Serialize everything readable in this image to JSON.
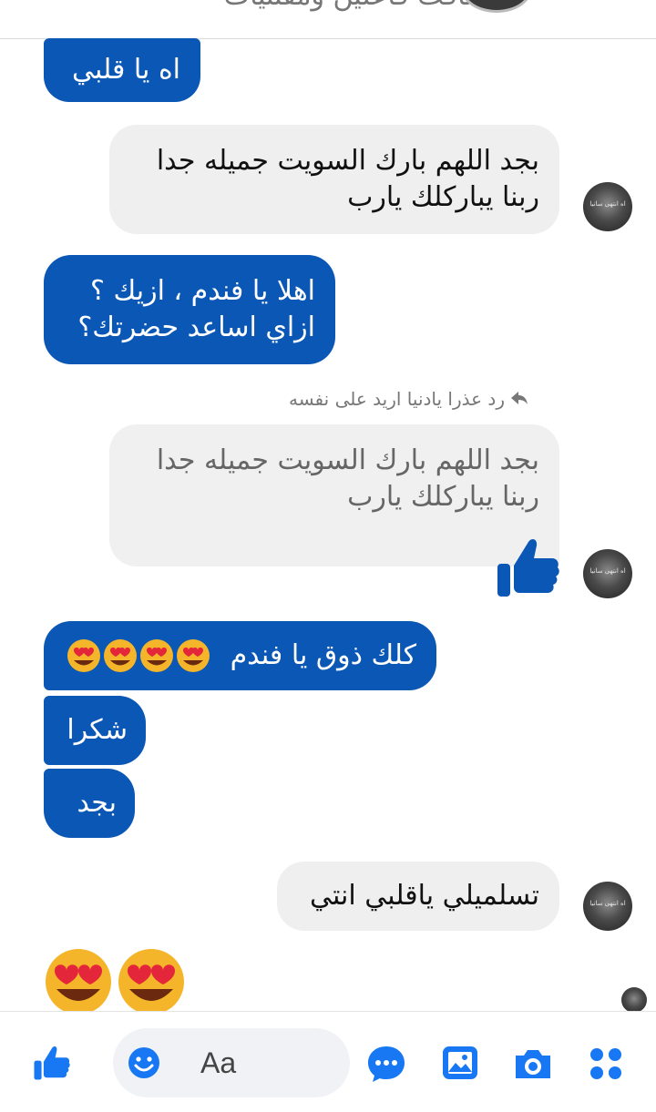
{
  "header": {
    "title_fragment": "أضافت فاعلين ومقتنيات"
  },
  "messages": [
    {
      "id": "m1",
      "type": "sent",
      "text": "اه يا قلبي"
    },
    {
      "id": "m2",
      "type": "received",
      "lines": [
        "بجد اللهم بارك السويت جميله جدا",
        "ربنا يباركلك يارب"
      ]
    },
    {
      "id": "m3",
      "type": "sent",
      "lines": [
        "اهلا يا فندم ، ازيك ؟",
        "ازاي اساعد حضرتك؟"
      ]
    },
    {
      "id": "m4",
      "type": "reply-quote",
      "reply_label": "رد عذرا يادنيا اريد على نفسه",
      "lines": [
        "بجد اللهم بارك السويت جميله جدا",
        "ربنا يباركلك يارب"
      ]
    },
    {
      "id": "m5",
      "type": "sent",
      "text": "كلك ذوق يا فندم"
    },
    {
      "id": "m6",
      "type": "sent",
      "text": "شكرا"
    },
    {
      "id": "m7",
      "type": "sent",
      "text": "بجد"
    },
    {
      "id": "m8",
      "type": "received",
      "text": "تسلميلي ياقلبي انتي"
    }
  ],
  "avatar_caption": "اه انتهى سانيا",
  "composer": {
    "placeholder": "Aa"
  },
  "icons": {
    "like": "thumbs-up-icon",
    "emoji": "smiley-icon",
    "more": "chat-bubble-dots-icon",
    "gallery": "image-icon",
    "camera": "camera-icon",
    "apps": "four-dots-icon"
  },
  "colors": {
    "sent_bubble": "#0b57b5",
    "received_bubble": "#efefef",
    "accent": "#1877f2"
  }
}
